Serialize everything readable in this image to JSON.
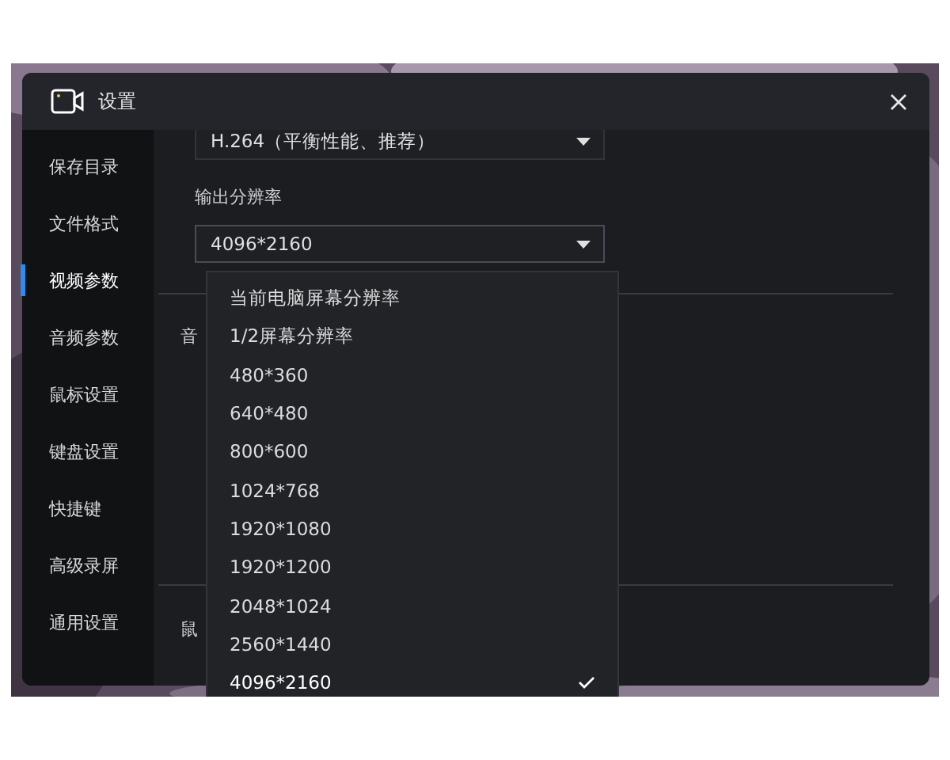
{
  "window": {
    "title": "设置"
  },
  "sidebar": {
    "items": [
      {
        "label": "保存目录",
        "selected": false
      },
      {
        "label": "文件格式",
        "selected": false
      },
      {
        "label": "视频参数",
        "selected": true
      },
      {
        "label": "音频参数",
        "selected": false
      },
      {
        "label": "鼠标设置",
        "selected": false
      },
      {
        "label": "键盘设置",
        "selected": false
      },
      {
        "label": "快捷键",
        "selected": false
      },
      {
        "label": "高级录屏",
        "selected": false
      },
      {
        "label": "通用设置",
        "selected": false
      }
    ]
  },
  "content": {
    "codec_select": {
      "value": "H.264（平衡性能、推荐）"
    },
    "resolution": {
      "label": "输出分辨率",
      "value": "4096*2160",
      "expanded": true,
      "options": [
        {
          "label": "当前电脑屏幕分辨率",
          "selected": false
        },
        {
          "label": "1/2屏幕分辨率",
          "selected": false
        },
        {
          "label": "480*360",
          "selected": false
        },
        {
          "label": "640*480",
          "selected": false
        },
        {
          "label": "800*600",
          "selected": false
        },
        {
          "label": "1024*768",
          "selected": false
        },
        {
          "label": "1920*1080",
          "selected": false
        },
        {
          "label": "1920*1200",
          "selected": false
        },
        {
          "label": "2048*1024",
          "selected": false
        },
        {
          "label": "2560*1440",
          "selected": false
        },
        {
          "label": "4096*2160",
          "selected": true
        }
      ]
    },
    "section_labels": [
      "音",
      "鼠"
    ]
  }
}
